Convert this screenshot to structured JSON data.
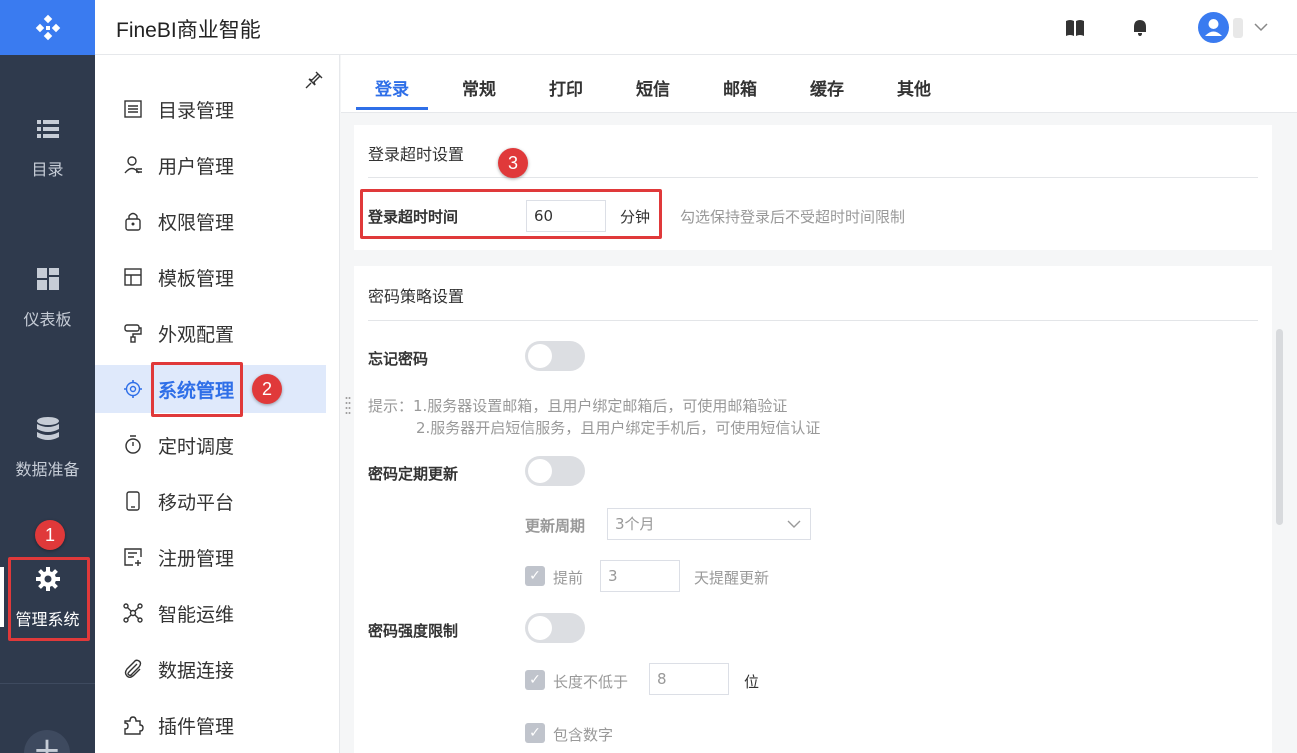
{
  "rail": {
    "items": [
      {
        "label": "目录"
      },
      {
        "label": "仪表板"
      },
      {
        "label": "数据准备"
      },
      {
        "label": "管理系统"
      }
    ]
  },
  "topbar": {
    "title": "FineBI商业智能"
  },
  "menu": {
    "items": [
      {
        "label": "目录管理"
      },
      {
        "label": "用户管理"
      },
      {
        "label": "权限管理"
      },
      {
        "label": "模板管理"
      },
      {
        "label": "外观配置"
      },
      {
        "label": "系统管理"
      },
      {
        "label": "定时调度"
      },
      {
        "label": "移动平台"
      },
      {
        "label": "注册管理"
      },
      {
        "label": "智能运维"
      },
      {
        "label": "数据连接"
      },
      {
        "label": "插件管理"
      }
    ]
  },
  "tabs": [
    {
      "label": "登录"
    },
    {
      "label": "常规"
    },
    {
      "label": "打印"
    },
    {
      "label": "短信"
    },
    {
      "label": "邮箱"
    },
    {
      "label": "缓存"
    },
    {
      "label": "其他"
    }
  ],
  "login_timeout": {
    "section_title": "登录超时设置",
    "label": "登录超时时间",
    "value": "60",
    "unit": "分钟",
    "hint": "勾选保持登录后不受超时时间限制"
  },
  "password_policy": {
    "section_title": "密码策略设置",
    "forget_label": "忘记密码",
    "tip_line1": "提示：1.服务器设置邮箱，且用户绑定邮箱后，可使用邮箱验证",
    "tip_line2": "2.服务器开启短信服务，且用户绑定手机后，可使用短信认证",
    "periodic_label": "密码定期更新",
    "period_label": "更新周期",
    "period_value": "3个月",
    "advance_label": "提前",
    "advance_value": "3",
    "advance_suffix": "天提醒更新",
    "strength_label": "密码强度限制",
    "min_length_label": "长度不低于",
    "min_length_value": "8",
    "min_length_unit": "位",
    "include_digits_label": "包含数字"
  },
  "annotations": [
    "1",
    "2",
    "3"
  ],
  "colors": {
    "accent": "#2f6fe8",
    "annotation": "#e0393a",
    "rail": "#2f3a4d"
  }
}
